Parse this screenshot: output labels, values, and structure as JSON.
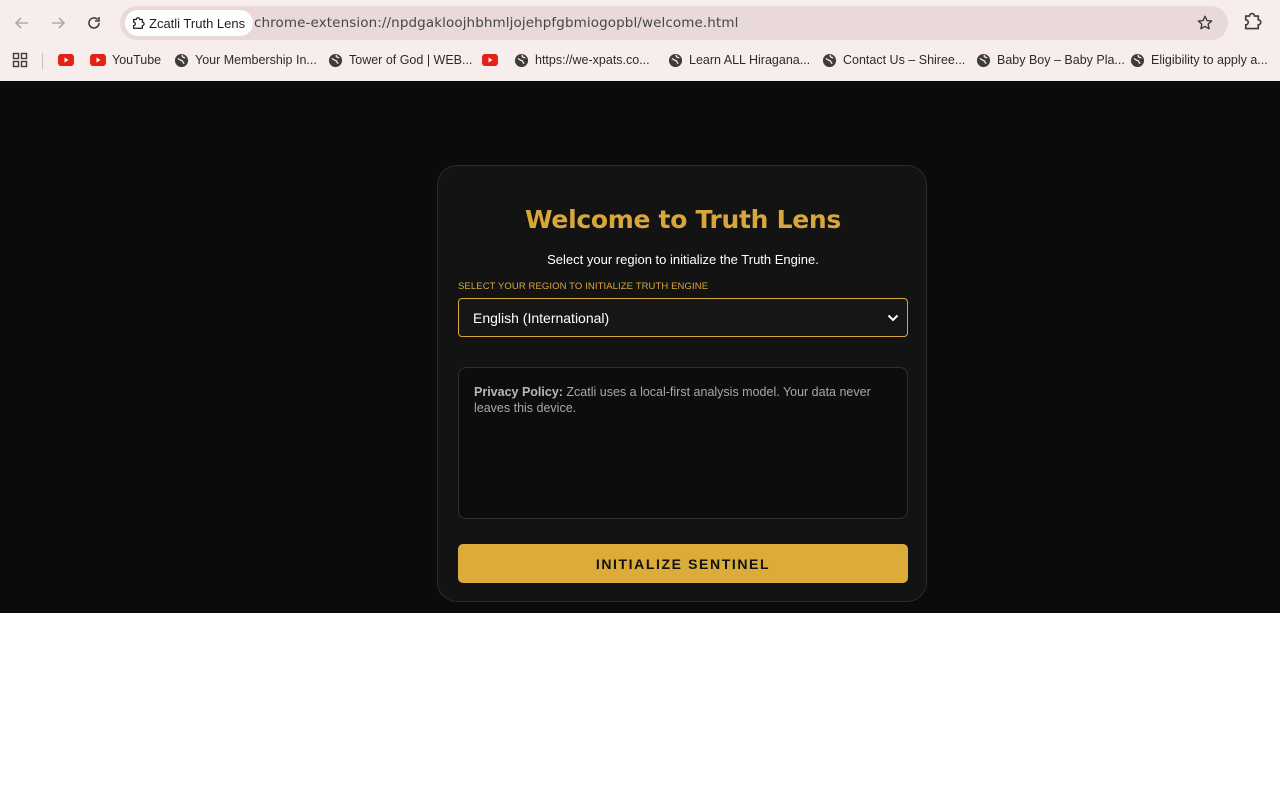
{
  "browser": {
    "tab_title": "Zcatli Truth Lens",
    "url": "chrome-extension://npdgakloojhbhmljojehpfgbmiogopbl/welcome.html"
  },
  "bookmarks": [
    {
      "label": "",
      "icon": "youtube-icon"
    },
    {
      "label": "YouTube",
      "icon": "youtube-icon"
    },
    {
      "label": "Your Membership In...",
      "icon": "globe-icon"
    },
    {
      "label": "Tower of God | WEB...",
      "icon": "globe-icon"
    },
    {
      "label": "",
      "icon": "youtube-icon"
    },
    {
      "label": "https://we-xpats.co...",
      "icon": "globe-icon"
    },
    {
      "label": "Learn ALL Hiragana...",
      "icon": "globe-icon"
    },
    {
      "label": "Contact Us – Shiree...",
      "icon": "globe-icon"
    },
    {
      "label": "Baby Boy – Baby Pla...",
      "icon": "globe-icon"
    },
    {
      "label": "Eligibility to apply a...",
      "icon": "globe-icon"
    }
  ],
  "welcome": {
    "title": "Welcome to Truth Lens",
    "subtitle": "Select your region to initialize the Truth Engine.",
    "select_label": "SELECT YOUR REGION TO INITIALIZE TRUTH ENGINE",
    "selected_region": "English (International)",
    "privacy_heading": "Privacy Policy:",
    "privacy_text": " Zcatli uses a local-first analysis model. Your data never leaves this device.",
    "button_label": "INITIALIZE SENTINEL"
  },
  "colors": {
    "accent": "#d8a73b",
    "page_background": "#0b0b0b",
    "card_background": "#131313"
  }
}
